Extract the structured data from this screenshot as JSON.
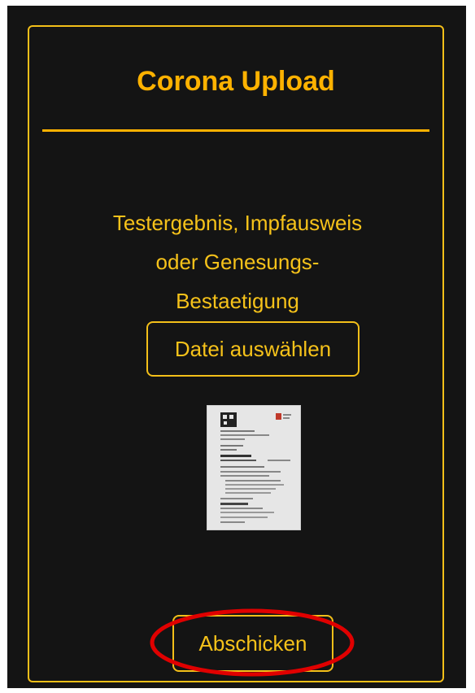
{
  "card": {
    "title": "Corona Upload",
    "description_lines": [
      "Testergebnis, Impfausweis",
      "oder Genesungs-",
      "Bestaetigung"
    ],
    "file_button_label": "Datei auswählen",
    "submit_button_label": "Abschicken"
  },
  "colors": {
    "background": "#141414",
    "accent": "#ffb200",
    "text": "#f6c21a",
    "highlight_ring": "#e00000"
  },
  "preview": {
    "icon": "document-scan-thumbnail"
  }
}
